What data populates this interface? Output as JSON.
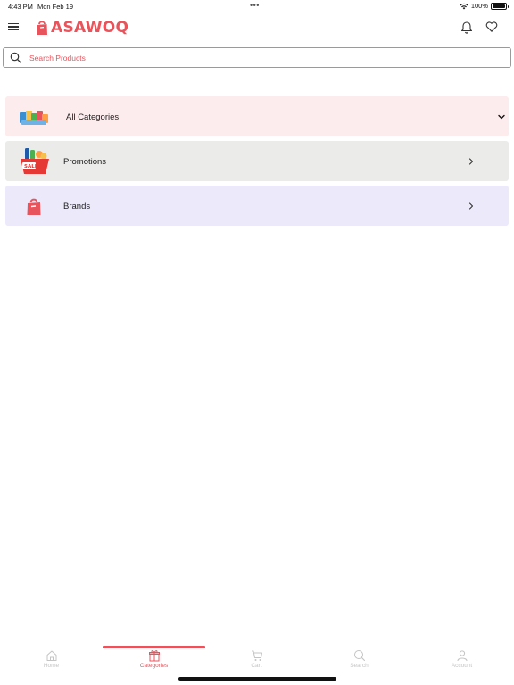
{
  "status_bar": {
    "time": "4:43 PM",
    "date": "Mon Feb 19",
    "dots": "•••",
    "battery": "100%",
    "icons": [
      "wifi-icon",
      "battery-icon"
    ]
  },
  "header": {
    "logo_text": "ASAWOQ",
    "icons": [
      "menu-icon",
      "bell-icon",
      "heart-icon"
    ]
  },
  "search": {
    "placeholder": "Search Products",
    "icon": "search-icon"
  },
  "categories": [
    {
      "label": "All Categories",
      "icon": "grocery-products-icon",
      "action": "chevron-down-icon",
      "color": "#fdeced"
    },
    {
      "label": "Promotions",
      "icon": "sale-basket-icon",
      "action": "chevron-right-icon",
      "color": "#ebebea"
    },
    {
      "label": "Brands",
      "icon": "shopping-bag-icon",
      "action": "chevron-right-icon",
      "color": "#ece9fb"
    }
  ],
  "tabs": [
    {
      "label": "Home",
      "icon": "home-icon",
      "active": false
    },
    {
      "label": "Categories",
      "icon": "gift-box-icon",
      "active": true
    },
    {
      "label": "Cart",
      "icon": "cart-icon",
      "active": false
    },
    {
      "label": "Search",
      "icon": "search-icon",
      "active": false
    },
    {
      "label": "Account",
      "icon": "user-icon",
      "active": false
    }
  ],
  "colors": {
    "brand": "#e8545c",
    "inactive_tab": "#c4c4c4"
  }
}
